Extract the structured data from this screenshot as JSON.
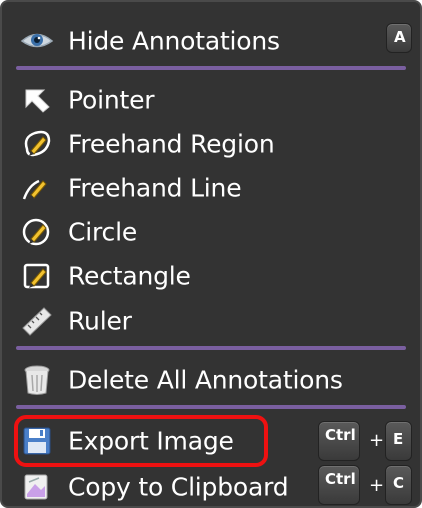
{
  "menu": {
    "hide_annotations": {
      "label": "Hide Annotations",
      "icon": "eye-icon",
      "shortcut": "A"
    },
    "tools": [
      {
        "label": "Pointer",
        "icon": "pointer-arrow-icon"
      },
      {
        "label": "Freehand Region",
        "icon": "freehand-region-icon"
      },
      {
        "label": "Freehand Line",
        "icon": "freehand-line-icon"
      },
      {
        "label": "Circle",
        "icon": "circle-tool-icon"
      },
      {
        "label": "Rectangle",
        "icon": "rectangle-tool-icon"
      },
      {
        "label": "Ruler",
        "icon": "ruler-icon"
      }
    ],
    "delete_all": {
      "label": "Delete All Annotations",
      "icon": "trash-icon"
    },
    "export_image": {
      "label": "Export Image",
      "icon": "floppy-disk-icon",
      "modifier": "Ctrl",
      "plus": "+",
      "key": "E"
    },
    "copy_clipboard": {
      "label": "Copy to Clipboard",
      "icon": "clipboard-copy-icon",
      "modifier": "Ctrl",
      "plus": "+",
      "key": "C"
    }
  },
  "colors": {
    "background": "#333333",
    "divider": "#7a5fa0",
    "highlight": "#ee1111",
    "text": "#ffffff"
  }
}
